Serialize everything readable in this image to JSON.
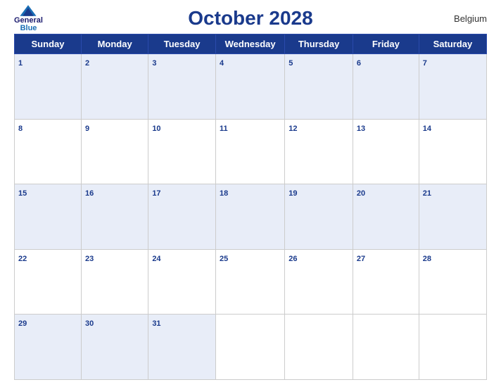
{
  "header": {
    "title": "October 2028",
    "country": "Belgium",
    "logo": {
      "general": "General",
      "blue": "Blue"
    }
  },
  "days_of_week": [
    "Sunday",
    "Monday",
    "Tuesday",
    "Wednesday",
    "Thursday",
    "Friday",
    "Saturday"
  ],
  "weeks": [
    [
      1,
      2,
      3,
      4,
      5,
      6,
      7
    ],
    [
      8,
      9,
      10,
      11,
      12,
      13,
      14
    ],
    [
      15,
      16,
      17,
      18,
      19,
      20,
      21
    ],
    [
      22,
      23,
      24,
      25,
      26,
      27,
      28
    ],
    [
      29,
      30,
      31,
      null,
      null,
      null,
      null
    ]
  ]
}
